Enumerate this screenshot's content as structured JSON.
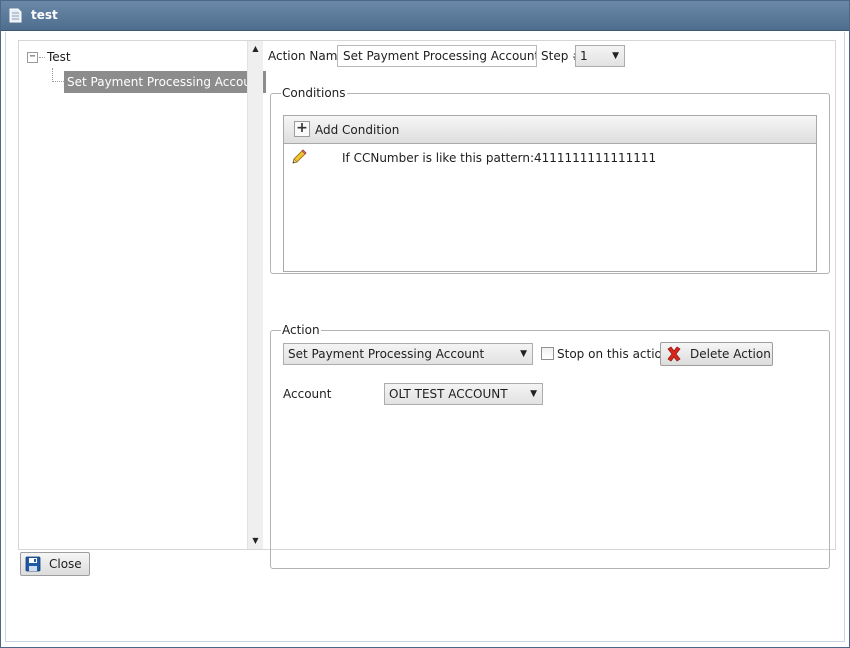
{
  "window": {
    "title": "test"
  },
  "tree": {
    "root": {
      "label": "Test",
      "expander": "−"
    },
    "children": [
      {
        "label": "Set Payment Processing Account"
      }
    ]
  },
  "scrollbar": {
    "up_glyph": "▲",
    "down_glyph": "▼"
  },
  "header": {
    "action_name_label": "Action Name",
    "action_name_value": "Set Payment Processing Account",
    "step_label": "Step #",
    "step_value": "1"
  },
  "conditions": {
    "legend": "Conditions",
    "add_button_glyph": "+",
    "add_button_label": "Add Condition",
    "items": [
      {
        "text": "If CCNumber is like this pattern:4111111111111111",
        "icon": "pencil-icon"
      }
    ]
  },
  "action": {
    "legend": "Action",
    "type_value": "Set Payment Processing Account",
    "stop_label": "Stop on this action",
    "stop_checked": false,
    "delete_label": "Delete Action",
    "account_label": "Account",
    "account_value": "OLT TEST ACCOUNT"
  },
  "footer": {
    "close_label": "Close"
  },
  "icons": {
    "dropdown_arrow": "▼"
  },
  "colors": {
    "titlebar": "#5a7898",
    "selection": "#8c8c8c",
    "delete_icon": "#d9251c",
    "save_icon": "#1f5aa6"
  }
}
